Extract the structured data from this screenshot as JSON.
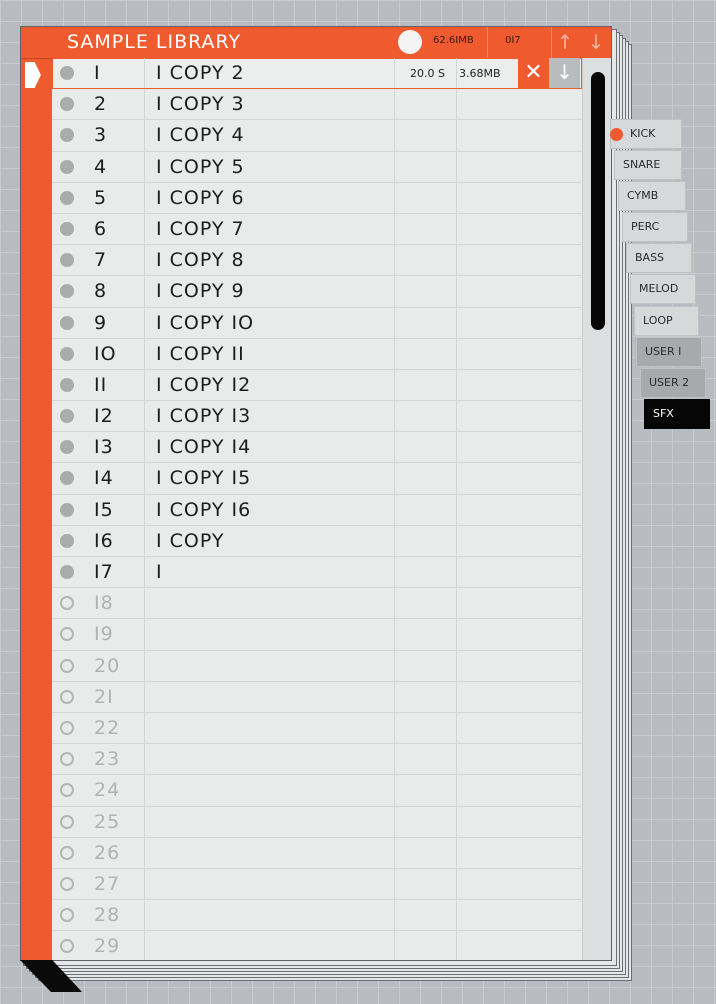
{
  "header": {
    "title": "SAMPLE LIBRARY",
    "memory": "62.6IMB",
    "count": "0I7",
    "up_icon": "arrow-up-icon",
    "down_icon": "arrow-down-icon"
  },
  "selected_row": {
    "duration": "20.0 S",
    "size": "3.68MB",
    "delete_icon": "close-icon",
    "download_icon": "arrow-down-icon"
  },
  "rows": [
    {
      "num": "I",
      "name": "I COPY 2",
      "loaded": true
    },
    {
      "num": "2",
      "name": "I COPY 3",
      "loaded": true
    },
    {
      "num": "3",
      "name": "I COPY 4",
      "loaded": true
    },
    {
      "num": "4",
      "name": "I COPY 5",
      "loaded": true
    },
    {
      "num": "5",
      "name": "I COPY 6",
      "loaded": true
    },
    {
      "num": "6",
      "name": "I COPY 7",
      "loaded": true
    },
    {
      "num": "7",
      "name": "I COPY 8",
      "loaded": true
    },
    {
      "num": "8",
      "name": "I COPY 9",
      "loaded": true
    },
    {
      "num": "9",
      "name": "I COPY IO",
      "loaded": true
    },
    {
      "num": "IO",
      "name": "I COPY II",
      "loaded": true
    },
    {
      "num": "II",
      "name": "I COPY I2",
      "loaded": true
    },
    {
      "num": "I2",
      "name": "I COPY I3",
      "loaded": true
    },
    {
      "num": "I3",
      "name": "I COPY I4",
      "loaded": true
    },
    {
      "num": "I4",
      "name": "I COPY I5",
      "loaded": true
    },
    {
      "num": "I5",
      "name": "I COPY I6",
      "loaded": true
    },
    {
      "num": "I6",
      "name": "I COPY",
      "loaded": true
    },
    {
      "num": "I7",
      "name": "I",
      "loaded": true
    },
    {
      "num": "I8",
      "name": "",
      "loaded": false
    },
    {
      "num": "I9",
      "name": "",
      "loaded": false
    },
    {
      "num": "20",
      "name": "",
      "loaded": false
    },
    {
      "num": "2I",
      "name": "",
      "loaded": false
    },
    {
      "num": "22",
      "name": "",
      "loaded": false
    },
    {
      "num": "23",
      "name": "",
      "loaded": false
    },
    {
      "num": "24",
      "name": "",
      "loaded": false
    },
    {
      "num": "25",
      "name": "",
      "loaded": false
    },
    {
      "num": "26",
      "name": "",
      "loaded": false
    },
    {
      "num": "27",
      "name": "",
      "loaded": false
    },
    {
      "num": "28",
      "name": "",
      "loaded": false
    },
    {
      "num": "29",
      "name": "",
      "loaded": false
    }
  ],
  "categories": [
    {
      "label": "KICK",
      "selected": true,
      "style": "normal"
    },
    {
      "label": "SNARE",
      "selected": false,
      "style": "normal"
    },
    {
      "label": "CYMB",
      "selected": false,
      "style": "normal"
    },
    {
      "label": "PERC",
      "selected": false,
      "style": "normal"
    },
    {
      "label": "BASS",
      "selected": false,
      "style": "normal"
    },
    {
      "label": "MELOD",
      "selected": false,
      "style": "normal"
    },
    {
      "label": "LOOP",
      "selected": false,
      "style": "normal"
    },
    {
      "label": "USER I",
      "selected": false,
      "style": "user"
    },
    {
      "label": "USER 2",
      "selected": false,
      "style": "user"
    },
    {
      "label": "SFX",
      "selected": false,
      "style": "active"
    }
  ],
  "colors": {
    "accent": "#ef5b2f",
    "panel": "#e9ebea",
    "background": "#b8bcc0",
    "active_tab": "#060606"
  }
}
